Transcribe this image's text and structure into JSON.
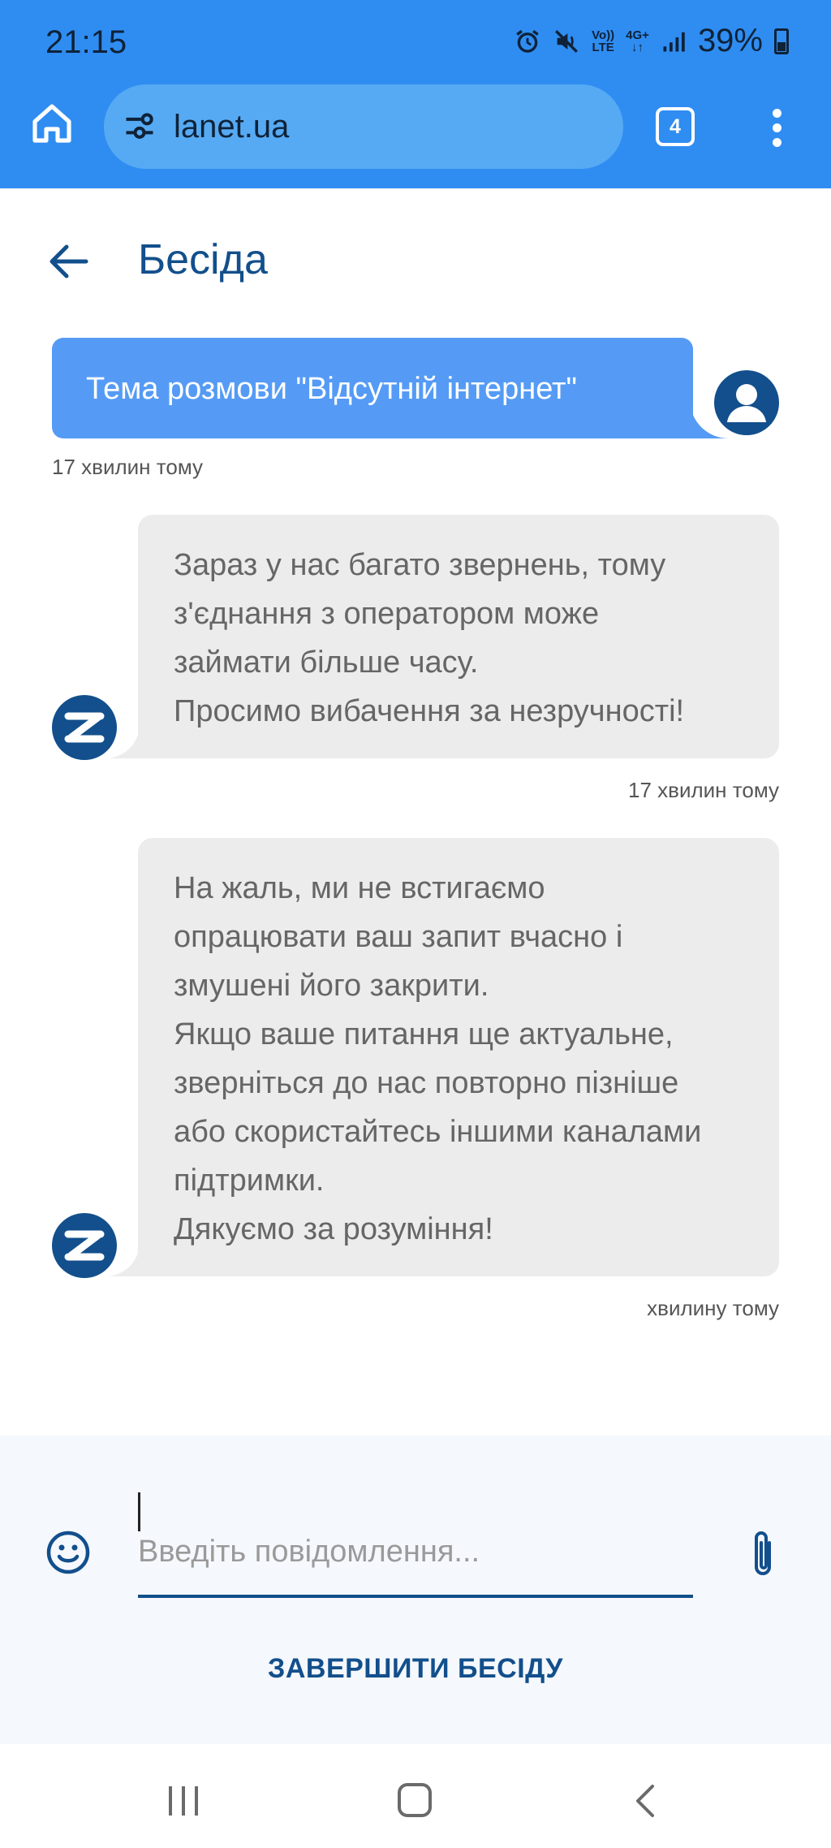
{
  "status_bar": {
    "time": "21:15",
    "volte_label_top": "Vo))",
    "volte_label_bottom": "LTE",
    "network_label": "4G+",
    "battery_percent": "39%"
  },
  "browser": {
    "url": "lanet.ua",
    "tab_count": "4",
    "icons": [
      "home-icon",
      "site-settings-icon",
      "tabs-icon",
      "more-vert-icon"
    ]
  },
  "header": {
    "title": "Бесіда",
    "back_icon": "arrow-left-icon"
  },
  "messages": [
    {
      "sender": "user",
      "lines": [
        "Тема розмови \"Відсутній інтернет\""
      ],
      "time": "17 хвилин тому"
    },
    {
      "sender": "bot",
      "lines": [
        "Зараз у нас багато звернень, тому",
        "з'єднання з оператором може",
        "займати більше часу.",
        "Просимо вибачення за незручності!"
      ],
      "time": "17 хвилин тому"
    },
    {
      "sender": "bot",
      "lines": [
        "На жаль, ми не встигаємо",
        "опрацювати ваш запит вчасно і",
        "змушені його закрити.",
        "Якщо ваше питання ще актуальне,",
        "зверніться до нас повторно пізніше",
        "або скористайтесь іншими каналами",
        "підтримки.",
        "Дякуємо за розуміння!"
      ],
      "time": "хвилину тому"
    }
  ],
  "composer": {
    "placeholder": "Введіть повідомлення...",
    "value": "",
    "end_chat_label": "ЗАВЕРШИТИ БЕСІДУ"
  },
  "colors": {
    "browser_bar": "#2f8df2",
    "brand": "#124f8c",
    "user_bubble": "#559bf5",
    "bot_bubble": "#ececec"
  }
}
